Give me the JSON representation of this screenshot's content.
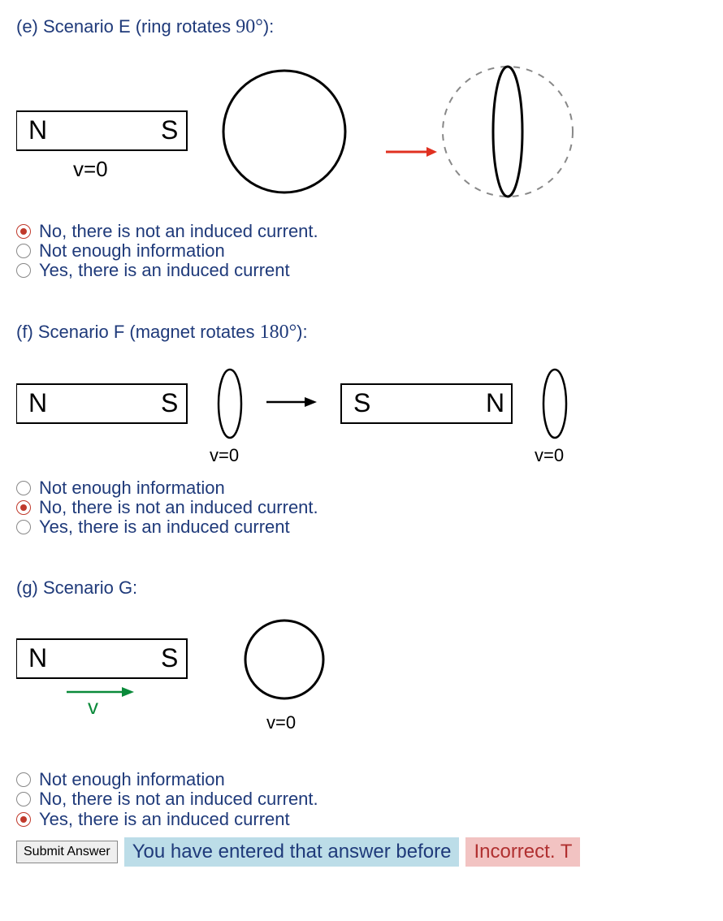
{
  "sections": {
    "e": {
      "prefix": "(e) Scenario E (ring rotates ",
      "angle": "90°",
      "suffix": "):",
      "options": [
        {
          "label": "No, there is not an induced current.",
          "selected": true
        },
        {
          "label": "Not enough information",
          "selected": false
        },
        {
          "label": "Yes, there is an induced current",
          "selected": false
        }
      ]
    },
    "f": {
      "prefix": "(f) Scenario F (magnet rotates ",
      "angle": "180°",
      "suffix": "):",
      "options": [
        {
          "label": "Not enough information",
          "selected": false
        },
        {
          "label": "No, there is not an induced current.",
          "selected": true
        },
        {
          "label": "Yes, there is an induced current",
          "selected": false
        }
      ]
    },
    "g": {
      "title": "(g) Scenario G:",
      "options": [
        {
          "label": "Not enough information",
          "selected": false
        },
        {
          "label": "No, there is not an induced current.",
          "selected": false
        },
        {
          "label": "Yes, there is an induced current",
          "selected": true
        }
      ]
    }
  },
  "labels": {
    "N": "N",
    "S": "S",
    "v0": "v=0",
    "v": "v"
  },
  "footer": {
    "submit": "Submit Answer",
    "msg1": "You have entered that answer before",
    "msg2": "Incorrect. T"
  }
}
